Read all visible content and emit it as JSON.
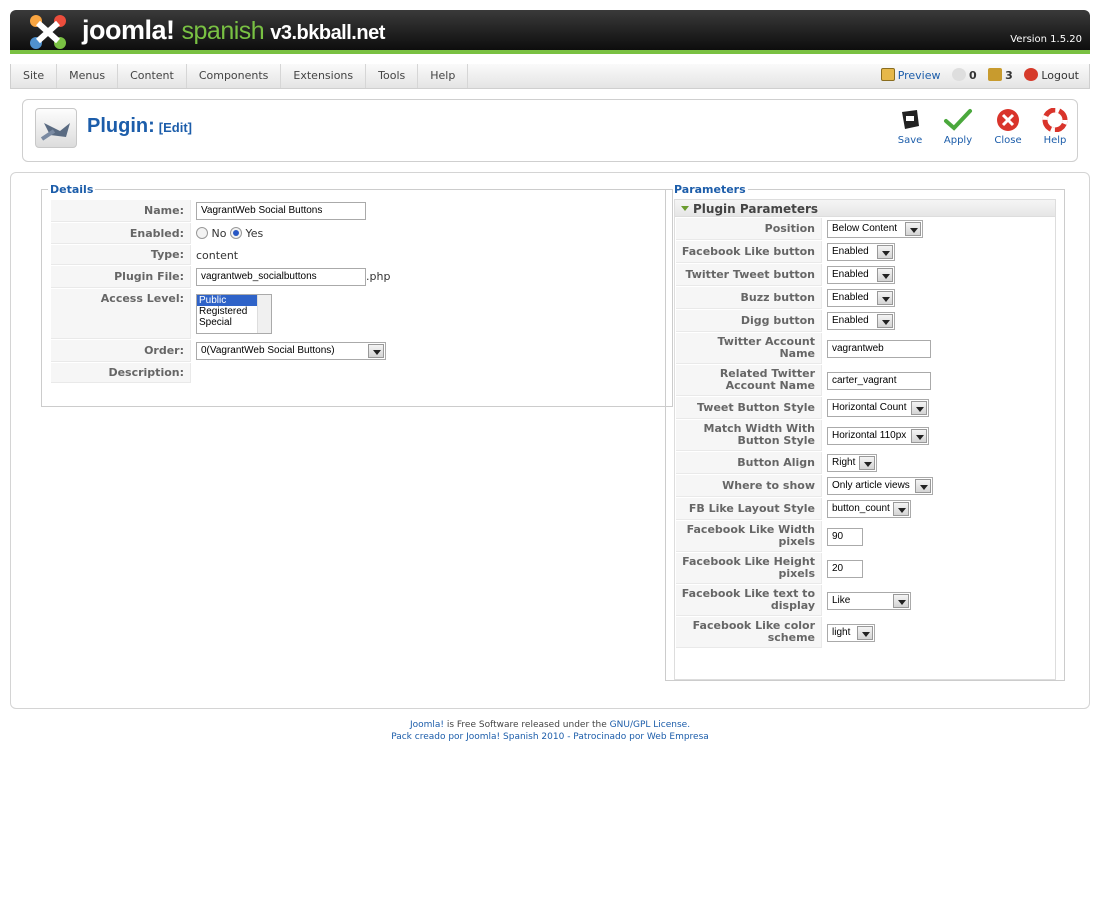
{
  "header": {
    "brand": "joomla!",
    "brand_sub": "spanish",
    "site": "v3.bkball.net",
    "version": "Version 1.5.20"
  },
  "menu": [
    "Site",
    "Menus",
    "Content",
    "Components",
    "Extensions",
    "Tools",
    "Help"
  ],
  "status": {
    "preview": "Preview",
    "messages": "0",
    "users": "3",
    "logout": "Logout"
  },
  "toolbar": {
    "title": "Plugin:",
    "subtitle": "[Edit]",
    "save": "Save",
    "apply": "Apply",
    "close": "Close",
    "help": "Help"
  },
  "details": {
    "legend": "Details",
    "name_label": "Name:",
    "name_value": "VagrantWeb Social Buttons",
    "enabled_label": "Enabled:",
    "no": "No",
    "yes": "Yes",
    "type_label": "Type:",
    "type_value": "content",
    "file_label": "Plugin File:",
    "file_value": "vagrantweb_socialbuttons",
    "file_ext": ".php",
    "access_label": "Access Level:",
    "access_options": [
      "Public",
      "Registered",
      "Special"
    ],
    "order_label": "Order:",
    "order_value": "0(VagrantWeb Social Buttons)",
    "desc_label": "Description:"
  },
  "params": {
    "legend": "Parameters",
    "section": "Plugin Parameters",
    "rows": [
      {
        "label": "Position",
        "type": "select",
        "value": "Below Content"
      },
      {
        "label": "Facebook Like button",
        "type": "select",
        "value": "Enabled"
      },
      {
        "label": "Twitter Tweet button",
        "type": "select",
        "value": "Enabled"
      },
      {
        "label": "Buzz button",
        "type": "select",
        "value": "Enabled"
      },
      {
        "label": "Digg button",
        "type": "select",
        "value": "Enabled"
      },
      {
        "label": "Twitter Account Name",
        "type": "input",
        "value": "vagrantweb"
      },
      {
        "label": "Related Twitter Account Name",
        "type": "input",
        "value": "carter_vagrant"
      },
      {
        "label": "Tweet Button Style",
        "type": "select",
        "value": "Horizontal Count"
      },
      {
        "label": "Match Width With Button Style",
        "type": "select",
        "value": "Horizontal 110px"
      },
      {
        "label": "Button Align",
        "type": "select",
        "value": "Right"
      },
      {
        "label": "Where to show",
        "type": "select",
        "value": "Only article views"
      },
      {
        "label": "FB Like Layout Style",
        "type": "select",
        "value": "button_count"
      },
      {
        "label": "Facebook Like Width pixels",
        "type": "input",
        "value": "90"
      },
      {
        "label": "Facebook Like Height pixels",
        "type": "input",
        "value": "20"
      },
      {
        "label": "Facebook Like text to display",
        "type": "select",
        "value": "Like"
      },
      {
        "label": "Facebook Like color scheme",
        "type": "select",
        "value": "light"
      }
    ]
  },
  "footer": {
    "line1_a": "Joomla!",
    "line1_b": " is Free Software released under the ",
    "line1_c": "GNU/GPL License.",
    "line2": "Pack creado por Joomla! Spanish 2010 - Patrocinado por Web Empresa"
  },
  "colors": {
    "brand_green": "#7ac142",
    "link_blue": "#1c5daa"
  }
}
